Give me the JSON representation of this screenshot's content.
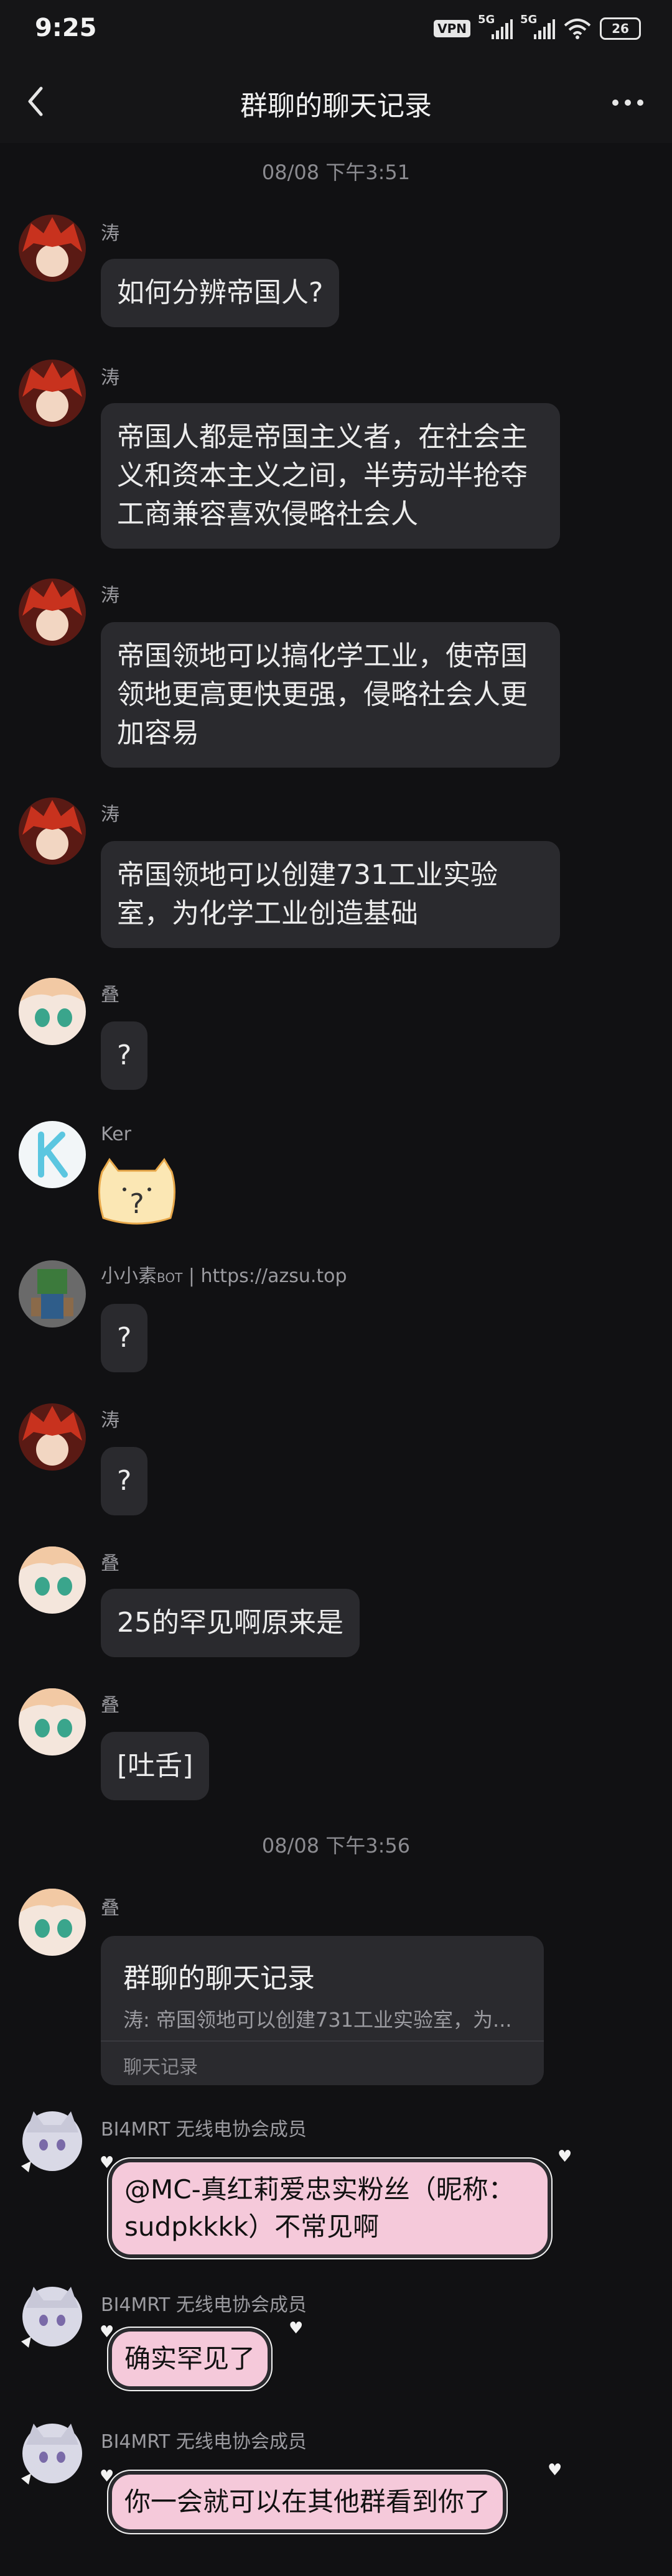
{
  "status": {
    "time": "9:25",
    "vpn": "VPN",
    "net1": "5G",
    "net2": "5G",
    "battery": "26"
  },
  "header": {
    "title": "群聊的聊天记录"
  },
  "timestamps": [
    "08/08 下午3:51",
    "08/08 下午3:56"
  ],
  "messages": [
    {
      "name": "涛",
      "text": "如何分辨帝国人?"
    },
    {
      "name": "涛",
      "text": "帝国人都是帝国主义者，在社会主义和资本主义之间，半劳动半抢夺工商兼容喜欢侵略社会人"
    },
    {
      "name": "涛",
      "text": "帝国领地可以搞化学工业，使帝国领地更高更快更强，侵略社会人更加容易"
    },
    {
      "name": "涛",
      "text": "帝国领地可以创建731工业实验室，为化学工业创造基础"
    },
    {
      "name": "叠",
      "text": "?"
    },
    {
      "name": "Ker",
      "sticker": "sticker-cat"
    },
    {
      "name_main": "小小素",
      "name_tag": "BOT",
      "name_sep": "|",
      "name_link": "https://azsu.top",
      "text": "?"
    },
    {
      "name": "涛",
      "text": "?"
    },
    {
      "name": "叠",
      "text": "25的罕见啊原来是"
    },
    {
      "name": "叠",
      "text": "[吐舌]"
    }
  ],
  "forward_card": {
    "name": "叠",
    "title": "群聊的聊天记录",
    "snippet": "涛: 帝国领地可以创建731工业实验室，为...",
    "footer": "聊天记录"
  },
  "bi4mrt": {
    "name": "BI4MRT 无线电协会成员",
    "messages": [
      "@MC-真红莉爱忠实粉丝（昵称：sudpkkkk）不常见啊",
      "确实罕见了",
      "你一会就可以在其他群看到你了"
    ]
  },
  "colors": {
    "background": "#111113",
    "bubble": "#2a2a2e",
    "pink_bubble": "#f5c9da"
  }
}
